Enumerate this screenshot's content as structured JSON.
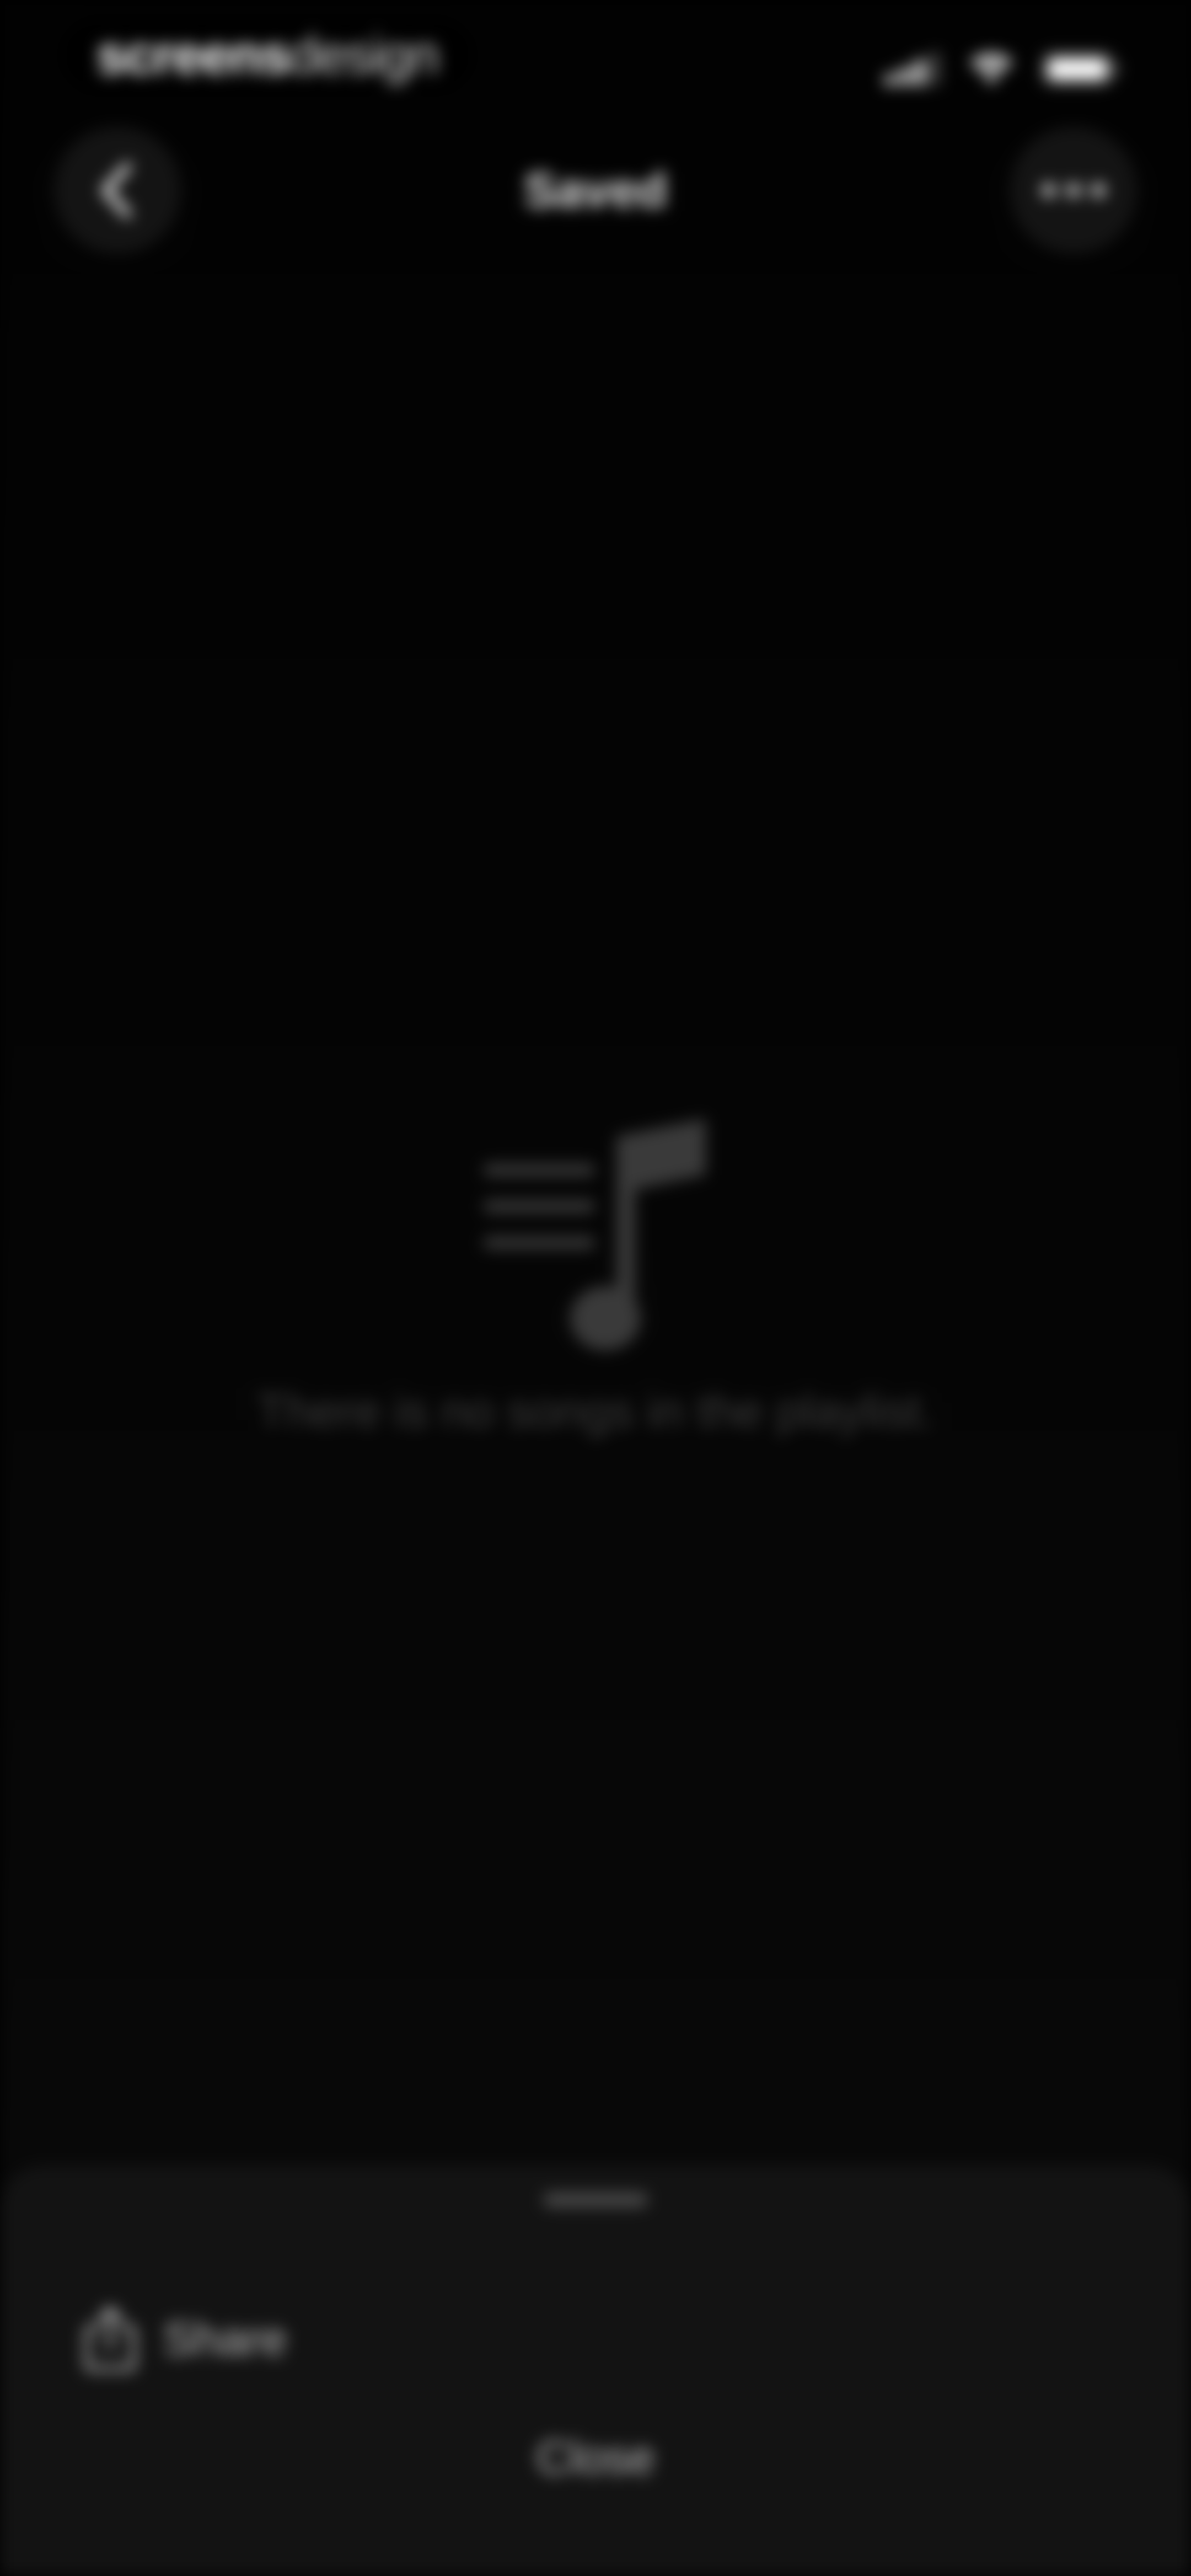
{
  "status_bar": {
    "brand_bold": "screens",
    "brand_light": "design",
    "icons": [
      "signal-icon",
      "wifi-icon",
      "battery-icon"
    ]
  },
  "nav": {
    "title": "Saved",
    "back_icon": "chevron-left-icon",
    "more_icon": "ellipsis-icon"
  },
  "empty_state": {
    "icon": "playlist-music-icon",
    "message": "There is no songs in the playlist."
  },
  "sheet": {
    "share_icon": "share-icon",
    "share_label": "Share",
    "close_label": "Close"
  },
  "colors": {
    "background": "#000000",
    "sheet": "#131313",
    "circle_button": "#141414",
    "muted_text": "#3b3b3b",
    "sheet_text": "#bdbdbd"
  }
}
